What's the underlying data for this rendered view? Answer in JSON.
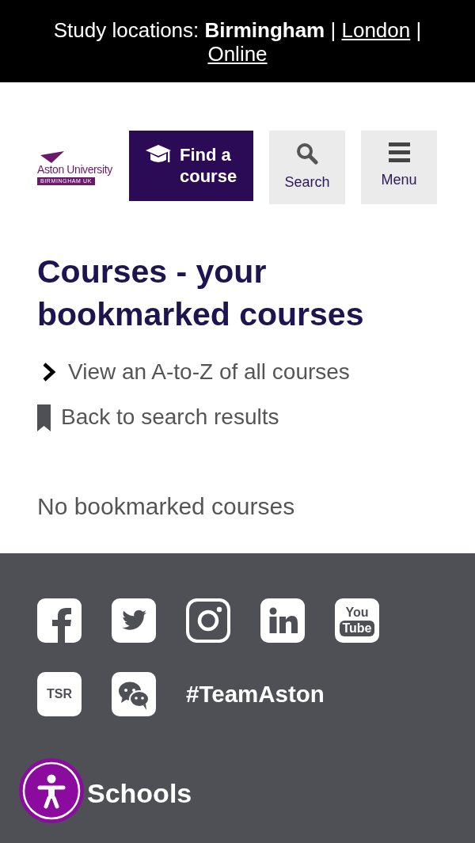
{
  "top_bar": {
    "items": [
      {
        "kind": "label",
        "text": "Study locations:"
      },
      {
        "kind": "current",
        "text": "Birmingham"
      },
      {
        "kind": "separator",
        "text": "|"
      },
      {
        "kind": "link",
        "text": "London"
      },
      {
        "kind": "separator",
        "text": "|"
      },
      {
        "kind": "link",
        "text": "Online"
      }
    ]
  },
  "header": {
    "logo": {
      "name": "Aston University",
      "tagline": "BIRMINGHAM UK"
    },
    "buttons": [
      {
        "kind": "find",
        "label": "Find a course"
      },
      {
        "kind": "search",
        "label": "Search"
      },
      {
        "kind": "menu",
        "label": "Menu"
      }
    ]
  },
  "main": {
    "title": "Courses - your bookmarked courses",
    "links": [
      {
        "kind": "chevron",
        "label": "View an A-to-Z of all courses"
      },
      {
        "kind": "bookmark",
        "label": "Back to search results"
      }
    ],
    "empty_message": "No bookmarked courses"
  },
  "footer": {
    "youtube_label": [
      "You",
      "Tube"
    ],
    "tsr_label": "TSR",
    "hashtag": "#TeamAston",
    "heading": "Schools"
  }
}
